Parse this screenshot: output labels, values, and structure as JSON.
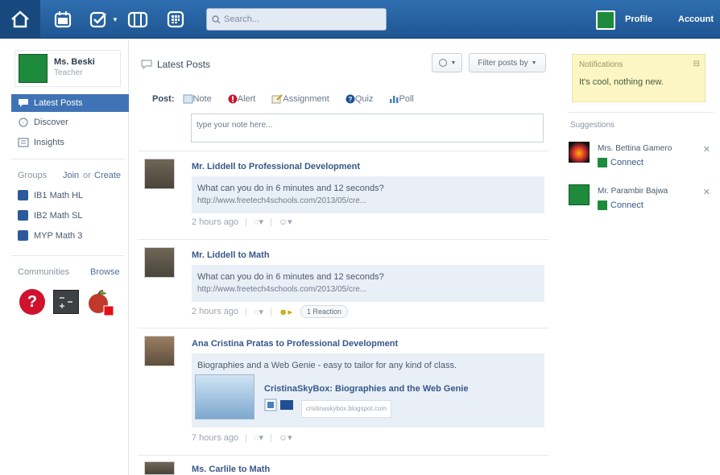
{
  "topbar": {
    "search_placeholder": "Search...",
    "profile_label": "Profile",
    "account_label": "Account"
  },
  "sidebar": {
    "user_name": "Ms. Beski",
    "user_role": "Teacher",
    "nav": [
      {
        "label": "Latest Posts"
      },
      {
        "label": "Discover"
      },
      {
        "label": "Insights"
      }
    ],
    "groups_label": "Groups",
    "join_label": "Join",
    "or_label": "or",
    "create_label": "Create",
    "groups": [
      {
        "label": "IB1 Math HL",
        "color": "#2a5a9a"
      },
      {
        "label": "IB2 Math SL",
        "color": "#2a5a9a"
      },
      {
        "label": "MYP Math 3",
        "color": "#2a5a9a"
      }
    ],
    "communities_label": "Communities",
    "browse_label": "Browse"
  },
  "main": {
    "title": "Latest Posts",
    "filter_label": "Filter posts by",
    "composer": {
      "post_label": "Post:",
      "options": [
        {
          "label": "Note"
        },
        {
          "label": "Alert"
        },
        {
          "label": "Assignment"
        },
        {
          "label": "Quiz"
        },
        {
          "label": "Poll"
        }
      ],
      "input_placeholder": "type your note here..."
    },
    "posts": [
      {
        "header": "Mr. Liddell to Professional Development",
        "text": "What can you do in 6 minutes and 12 seconds?",
        "url": "http://www.freetech4schools.com/2013/05/cre...",
        "time": "2 hours ago"
      },
      {
        "header": "Mr. Liddell to Math",
        "text": "What can you do in 6 minutes and 12 seconds?",
        "url": "http://www.freetech4schools.com/2013/05/cre...",
        "time": "2 hours ago",
        "reaction": "1 Reaction"
      },
      {
        "header": "Ana Cristina Pratas to Professional Development",
        "text": "Biographies and a Web Genie - easy to tailor for any kind of class.",
        "link_title": "CristinaSkyBox: Biographies and the Web Genie",
        "link_source": "cristinaskybox.blogspot.com",
        "time": "7 hours ago"
      },
      {
        "header": "Ms. Carlile to Math"
      }
    ]
  },
  "rail": {
    "notifications_title": "Notifications",
    "notifications_text": "It's cool, nothing new.",
    "suggestions_label": "Suggestions",
    "suggestions": [
      {
        "name": "Mrs. Bettina Gamero",
        "connect": "Connect"
      },
      {
        "name": "Mr. Parambir Bajwa",
        "connect": "Connect"
      }
    ]
  },
  "colors": {
    "topbar": "#2f6fb0",
    "active_nav": "#3f73b5",
    "link": "#35588a",
    "post_body_bg": "#e9eff6",
    "notification_bg": "#fbf6c4"
  }
}
